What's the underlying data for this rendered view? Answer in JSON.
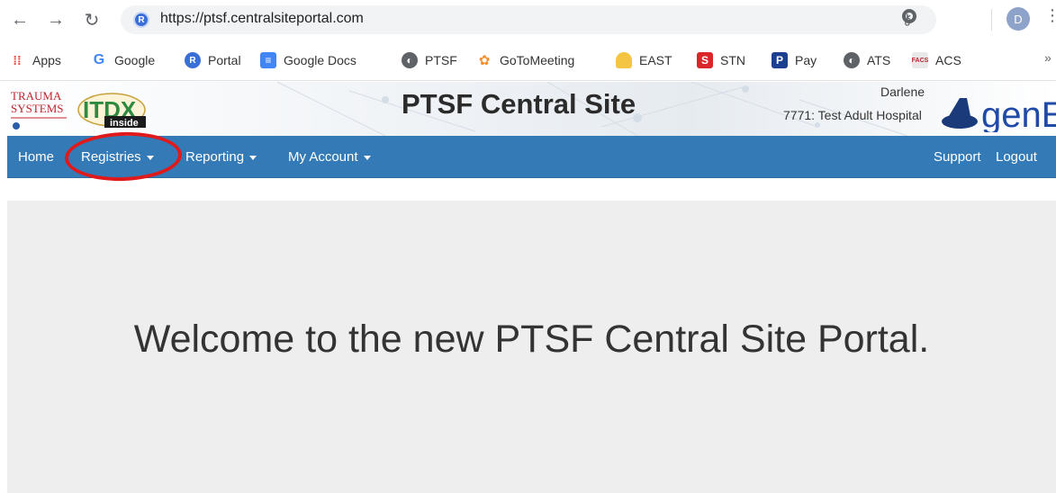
{
  "browser": {
    "url": "https://ptsf.centralsiteportal.com",
    "site_badge": "R",
    "profile_initial": "D",
    "bookmarks": [
      {
        "label": "Apps",
        "icon": "apps-grid-icon"
      },
      {
        "label": "Google",
        "icon": "google-icon"
      },
      {
        "label": "Portal",
        "icon": "portal-icon"
      },
      {
        "label": "Google Docs",
        "icon": "docs-icon"
      },
      {
        "label": "PTSF",
        "icon": "globe-icon"
      },
      {
        "label": "GoToMeeting",
        "icon": "gotomeeting-icon"
      },
      {
        "label": "EAST",
        "icon": "east-icon"
      },
      {
        "label": "STN",
        "icon": "stn-icon"
      },
      {
        "label": "Pay",
        "icon": "paypal-icon"
      },
      {
        "label": "ATS",
        "icon": "globe-icon"
      },
      {
        "label": "ACS",
        "icon": "facs-icon"
      }
    ],
    "bookmarks_overflow": "»"
  },
  "header": {
    "title": "PTSF Central Site",
    "user_name": "Darlene",
    "hospital": "7771: Test Adult Hospital",
    "logos": {
      "ptsf_line1": "TRAUMA",
      "ptsf_line2": "SYSTEMS",
      "itdx_main": "ITDX",
      "itdx_sub": "inside",
      "gene": "genE"
    }
  },
  "nav": {
    "home": "Home",
    "registries": "Registries",
    "reporting": "Reporting",
    "my_account": "My Account",
    "support": "Support",
    "logout": "Logout"
  },
  "main": {
    "welcome": "Welcome to the new PTSF Central Site Portal."
  },
  "colors": {
    "navbar": "#337ab7",
    "highlight": "#e0191b",
    "jumbotron": "#eeeeee"
  }
}
